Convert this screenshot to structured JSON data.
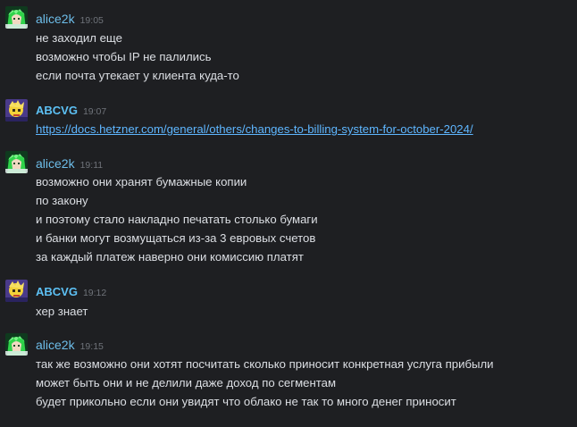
{
  "messages": [
    {
      "author": "alice2k",
      "avatar": "green-hair-anime-avatar-icon",
      "time": "19:05",
      "lines": [
        "не заходил еще",
        "возможно чтобы IP не палились",
        "если почта утекает у клиента куда-то"
      ]
    },
    {
      "author": "ABCVG",
      "avatar": "yellow-character-avatar-icon",
      "time": "19:07",
      "lines": [
        "https://docs.hetzner.com/general/others/changes-to-billing-system-for-october-2024/"
      ]
    },
    {
      "author": "alice2k",
      "avatar": "green-hair-anime-avatar-icon",
      "time": "19:11",
      "lines": [
        "возможно они хранят бумажные копии",
        "по закону",
        "и поэтому стало накладно печатать столько бумаги",
        "и банки могут возмущаться из-за 3 евровых счетов",
        "за каждый платеж наверно они комиссию платят"
      ]
    },
    {
      "author": "ABCVG",
      "avatar": "yellow-character-avatar-icon",
      "time": "19:12",
      "lines": [
        "хер знает"
      ]
    },
    {
      "author": "alice2k",
      "avatar": "green-hair-anime-avatar-icon",
      "time": "19:15",
      "lines": [
        "так же возможно они хотят посчитать сколько приносит конкретная услуга прибыли",
        "может быть они и не делили даже доход по сегментам",
        "будет прикольно если они увидят что облако не так то много денег приносит"
      ]
    }
  ]
}
